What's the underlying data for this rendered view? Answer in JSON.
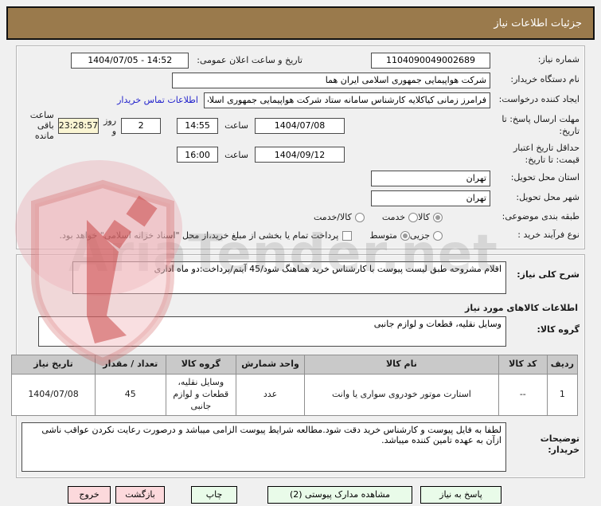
{
  "title": "جزئیات اطلاعات نیاز",
  "watermark": "AriaTender.net",
  "form": {
    "need_number_label": "شماره نیاز:",
    "need_number": "1104090049002689",
    "announce_label": "تاریخ و ساعت اعلان عمومی:",
    "announce_value": "1404/07/05 - 14:52",
    "buyer_org_label": "نام دستگاه خریدار:",
    "buyer_org": "شرکت هواپیمایی جمهوری اسلامی ایران هما",
    "creator_label": "ایجاد کننده درخواست:",
    "creator": "فرامرز زمانی کیاکلایه کارشناس سامانه ستاد شرکت هواپیمایی جمهوری اسلام",
    "contact_link": "اطلاعات تماس خریدار",
    "deadline_label": "مهلت ارسال پاسخ: تا تاریخ:",
    "deadline_date": "1404/07/08",
    "hour_label": "ساعت",
    "deadline_time": "14:55",
    "days_value": "2",
    "days_and_label": "روز و",
    "countdown": "23:28:57",
    "remaining_label": "ساعت باقی مانده",
    "validity_label": "حداقل تاریخ اعتبار قیمت: تا تاریخ:",
    "validity_date": "1404/09/12",
    "validity_time": "16:00",
    "province_label": "استان محل تحویل:",
    "province": "تهران",
    "city_label": "شهر محل تحویل:",
    "city": "تهران",
    "classification_label": "طبقه بندی موضوعی:",
    "class_goods": "کالا",
    "class_service": "خدمت",
    "class_both": "کالا/خدمت",
    "process_label": "نوع فرآیند خرید :",
    "process_minor": "جزیی",
    "process_medium": "متوسط",
    "treasury_note": "پرداخت تمام یا بخشی از مبلغ خرید،از محل \"اسناد خزانه اسلامی\" خواهد بود."
  },
  "need_desc": {
    "label": "شرح کلی نیاز:",
    "value": "اقلام مشروحه طبق لیست پیوست با کارشناس خرید هماهنگ شود/45 آیتم/پرداخت:دو ماه اداری"
  },
  "goods_section": {
    "header": "اطلاعات کالاهای مورد نیاز",
    "group_label": "گروه کالا:",
    "group_value": "وسایل نقلیه، قطعات و لوازم جانبی"
  },
  "table": {
    "headers": [
      "ردیف",
      "کد کالا",
      "نام کالا",
      "واحد شمارش",
      "گروه کالا",
      "تعداد / مقدار",
      "تاریخ نیاز"
    ],
    "row": {
      "index": "1",
      "code": "--",
      "name": "استارت موتور خودروی سواری یا وانت",
      "unit": "عدد",
      "group": "وسایل نقلیه، قطعات و لوازم جانبی",
      "qty": "45",
      "need_date": "1404/07/08"
    }
  },
  "buyer_notes": {
    "label": "توضیحات خریدار:",
    "value": "لطفا به فایل پیوست و کارشناس خرید دقت شود.مطالعه شرایط پیوست الزامی میباشد و درصورت رعایت نکردن عواقب ناشی ازآن به عهده تامین کننده میباشد."
  },
  "buttons": {
    "respond": "پاسخ به نیاز",
    "view_docs": "مشاهده مدارک پیوستی (2)",
    "print": "چاپ",
    "back": "بازگشت",
    "exit": "خروج"
  },
  "colors": {
    "accent_brown": "#9a7a4c",
    "button_green": "#e9fbe9",
    "button_pink": "#fcd9dc",
    "countdown_yellow": "#faf5d3",
    "link_blue": "#2222cc"
  }
}
